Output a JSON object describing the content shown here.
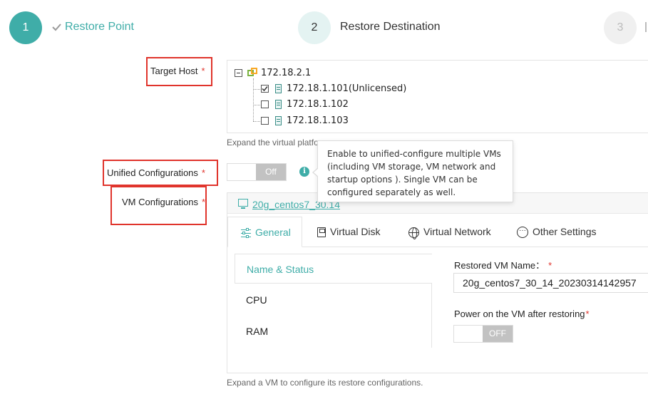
{
  "stepper": {
    "steps": [
      {
        "number": "1",
        "label": "Restore Point",
        "state": "completed"
      },
      {
        "number": "2",
        "label": "Restore Destination",
        "state": "active"
      },
      {
        "number": "3",
        "label": "",
        "state": "pending"
      }
    ]
  },
  "target_host": {
    "label": "Target Host",
    "required_mark": "*",
    "tree": {
      "root": "172.18.2.1",
      "hosts": [
        {
          "label": "172.18.1.101(Unlicensed)",
          "checked": true
        },
        {
          "label": "172.18.1.102",
          "checked": false
        },
        {
          "label": "172.18.1.103",
          "checked": false
        }
      ]
    },
    "hint": "Expand the virtual platfo"
  },
  "unified_configurations": {
    "label": "Unified Configurations",
    "required_mark": "*",
    "toggle_label": "Off",
    "tooltip": "Enable to unified-configure multiple VMs (including VM storage, VM network and startup options ). Single VM can be configured separately as well."
  },
  "vm_configurations": {
    "label": "VM Configurations",
    "required_mark": "*",
    "vm_name_link": "20g_centos7_30.14",
    "tabs": [
      {
        "label": "General",
        "icon": "sliders-icon",
        "active": true
      },
      {
        "label": "Virtual Disk",
        "icon": "disk-icon",
        "active": false
      },
      {
        "label": "Virtual Network",
        "icon": "globe-icon",
        "active": false
      },
      {
        "label": "Other Settings",
        "icon": "more-icon",
        "active": false
      }
    ],
    "side_nav": [
      {
        "label": "Name & Status",
        "active": true
      },
      {
        "label": "CPU",
        "active": false
      },
      {
        "label": "RAM",
        "active": false
      }
    ],
    "restored_vm_name_label": "Restored VM Name：",
    "restored_vm_name_required": "*",
    "restored_vm_name_value": "20g_centos7_30_14_20230314142957",
    "power_on_label": "Power on the VM after restoring",
    "power_on_required": "*",
    "power_on_toggle": "OFF",
    "hint": "Expand a VM to configure its restore configurations."
  },
  "colors": {
    "accent": "#3fada8",
    "required": "#e0342c",
    "annotation_box": "#e0342c"
  }
}
